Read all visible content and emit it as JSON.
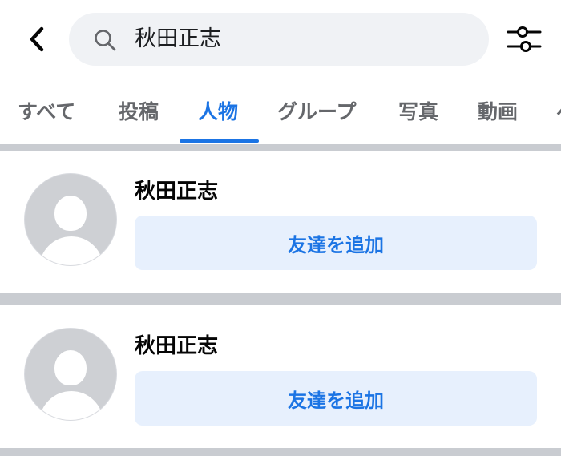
{
  "header": {
    "search_query": "秋田正志"
  },
  "tabs": [
    {
      "label": "すべて",
      "active": false
    },
    {
      "label": "投稿",
      "active": false
    },
    {
      "label": "人物",
      "active": true
    },
    {
      "label": "グループ",
      "active": false
    },
    {
      "label": "写真",
      "active": false
    },
    {
      "label": "動画",
      "active": false
    },
    {
      "label": "ペ",
      "active": false
    }
  ],
  "results": [
    {
      "name": "秋田正志",
      "action_label": "友達を追加"
    },
    {
      "name": "秋田正志",
      "action_label": "友達を追加"
    }
  ],
  "colors": {
    "accent": "#1b74e4",
    "button_bg": "#e7f0fd",
    "divider": "#c9ccd1",
    "search_bg": "#f0f2f5"
  },
  "icons": {
    "back": "chevron-left-icon",
    "search": "search-icon",
    "filter": "filter-sliders-icon",
    "avatar": "default-avatar-icon"
  }
}
